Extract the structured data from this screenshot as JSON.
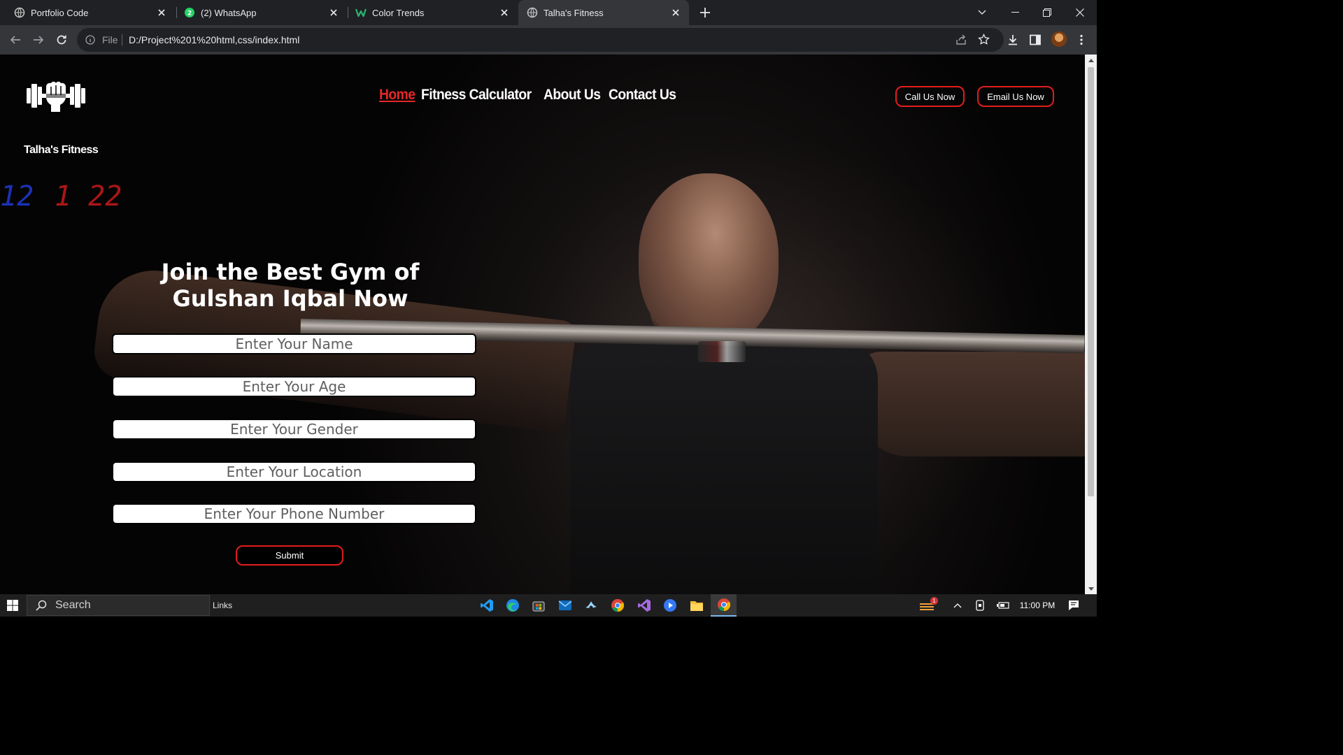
{
  "browser": {
    "tabs": [
      {
        "title": "Portfolio Code",
        "icon": "globe-icon",
        "active": false
      },
      {
        "title": "(2) WhatsApp",
        "icon": "whatsapp-icon",
        "active": false
      },
      {
        "title": "Color Trends",
        "icon": "color-trends-icon",
        "active": false
      },
      {
        "title": "Talha's Fitness",
        "icon": "globe-icon",
        "active": true
      }
    ],
    "omnibox": {
      "scheme_label": "File",
      "url": "D:/Project%201%20html,css/index.html"
    }
  },
  "site": {
    "brand": "Talha's Fitness",
    "nav": [
      {
        "label": "Home",
        "active": true
      },
      {
        "label": "Fitness Calculator",
        "active": false
      },
      {
        "label": "About Us",
        "active": false
      },
      {
        "label": "Contact Us",
        "active": false
      }
    ],
    "call_button": "Call Us Now",
    "email_button": "Email Us Now",
    "hero_title": "Join the Best Gym of Gulshan Iqbal Now",
    "background_clock_left": "12",
    "background_clock_right": "1 22",
    "form": {
      "fields": [
        {
          "placeholder": "Enter Your Name"
        },
        {
          "placeholder": "Enter Your Age"
        },
        {
          "placeholder": "Enter Your Gender"
        },
        {
          "placeholder": "Enter Your Location"
        },
        {
          "placeholder": "Enter Your Phone Number"
        }
      ],
      "submit": "Submit"
    },
    "colors": {
      "accent": "#e21d1d",
      "active_nav": "#e32727",
      "text": "#ffffff"
    }
  },
  "taskbar": {
    "search_placeholder": "Search",
    "links_label": "Links",
    "apps": [
      "vscode-icon",
      "edge-icon",
      "store-icon",
      "mail-icon",
      "steam-icon",
      "chrome-icon",
      "visual-studio-icon",
      "media-player-icon",
      "file-explorer-icon",
      "chrome-active-icon"
    ],
    "notification_badge": "1",
    "time": "11:00 PM"
  }
}
